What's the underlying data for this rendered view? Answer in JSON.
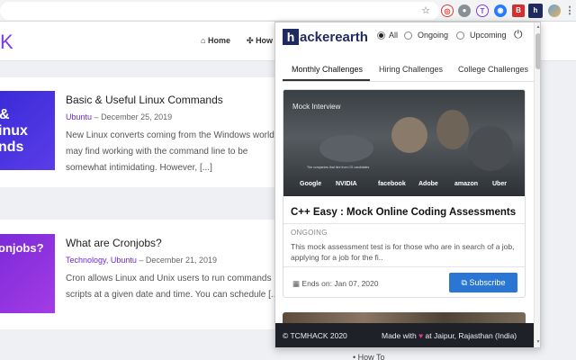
{
  "browser": {
    "address_text": "",
    "extensions": [
      "star-icon",
      "red-extension",
      "gray-extension",
      "purple-extension",
      "blue-extension",
      "red-b-extension",
      "gray-puzzle-extension",
      "hackerearth-extension",
      "avatar",
      "menu"
    ]
  },
  "site": {
    "logo_letter": "K",
    "nav": [
      "Home",
      "How"
    ],
    "posts": [
      {
        "thumb_lines": [
          "&",
          "inux",
          "nds"
        ],
        "title": "Basic & Useful Linux Commands",
        "category": "Ubuntu",
        "date": "December 25, 2019",
        "excerpt": [
          "New Linux converts coming from the Windows world",
          "may find working with the command line to be",
          "somewhat intimidating. However, [...]"
        ]
      },
      {
        "thumb_lines": [
          "onjobs?"
        ],
        "title": "What are Cronjobs?",
        "category": "Technology, Ubuntu",
        "date": "December 21, 2019",
        "excerpt": [
          "Cron allows Linux and Unix users to run commands",
          "scripts at a given date and time. You can schedule [...]"
        ]
      }
    ],
    "right_link": "How To"
  },
  "popup": {
    "logo_h": "h",
    "logo_text": "ackerearth",
    "filters": [
      {
        "label": "All",
        "selected": true
      },
      {
        "label": "Ongoing",
        "selected": false
      },
      {
        "label": "Upcoming",
        "selected": false
      }
    ],
    "tabs": [
      "Monthly Challenges",
      "Hiring Challenges",
      "College Challenges"
    ],
    "challenge": {
      "image_label": "Mock Interview",
      "image_caption": "The companies that hire from CS candidates",
      "brands": [
        "Google",
        "NVIDIA",
        "facebook",
        "Adobe",
        "amazon",
        "Uber"
      ],
      "title": "C++ Easy : Mock Online Coding Assessments",
      "status": "ONGOING",
      "description": "This mock assessment test is for those who are in search of a job, applying for a job for the fi..",
      "ends": "Ends on: Jan 07, 2020",
      "subscribe_label": "Subscribe"
    },
    "footer": {
      "copyright": "TCMHACK 2020",
      "made_with": "Made with",
      "location": "at Jaipur, Rajasthan (India)"
    }
  },
  "colors": {
    "accent_purple": "#6d28d9",
    "subscribe_blue": "#2a76d2",
    "footer_dark": "#1e2228",
    "hackerearth_navy": "#1f2a5e"
  }
}
